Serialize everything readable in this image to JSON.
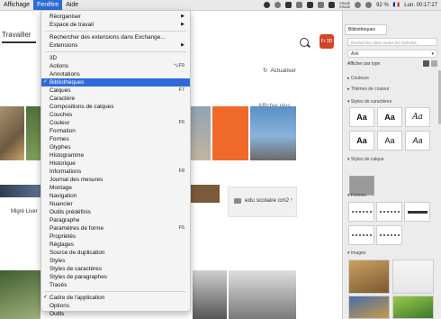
{
  "menubar": {
    "items": [
      "Affichage",
      "Fenêtre",
      "Aide"
    ],
    "right": {
      "erase_top": "ERASE",
      "erase_bottom": "ERASE",
      "battery": "92 %",
      "flag": "🇫🇷",
      "clock": "Lun. 00:17:27"
    }
  },
  "menu": {
    "rows": [
      {
        "label": "Réorganiser",
        "shortcut": "",
        "submenu": true,
        "check": false,
        "highlighted": false
      },
      {
        "label": "Espace de travail",
        "shortcut": "",
        "submenu": true,
        "check": false,
        "highlighted": false
      },
      {
        "label": "Rechercher des extensions dans Exchange...",
        "shortcut": "",
        "submenu": false,
        "check": false,
        "highlighted": false
      },
      {
        "label": "Extensions",
        "shortcut": "",
        "submenu": true,
        "check": false,
        "highlighted": false
      },
      {
        "label": "3D",
        "shortcut": "",
        "submenu": false,
        "check": false,
        "highlighted": false
      },
      {
        "label": "Actions",
        "shortcut": "⌥F9",
        "submenu": false,
        "check": false,
        "highlighted": false
      },
      {
        "label": "Annotations",
        "shortcut": "",
        "submenu": false,
        "check": false,
        "highlighted": false
      },
      {
        "label": "Bibliothèques",
        "shortcut": "",
        "submenu": false,
        "check": true,
        "highlighted": true
      },
      {
        "label": "Calques",
        "shortcut": "F7",
        "submenu": false,
        "check": false,
        "highlighted": false
      },
      {
        "label": "Caractère",
        "shortcut": "",
        "submenu": false,
        "check": false,
        "highlighted": false
      },
      {
        "label": "Compositions de calques",
        "shortcut": "",
        "submenu": false,
        "check": false,
        "highlighted": false
      },
      {
        "label": "Couches",
        "shortcut": "",
        "submenu": false,
        "check": false,
        "highlighted": false
      },
      {
        "label": "Couleur",
        "shortcut": "F6",
        "submenu": false,
        "check": false,
        "highlighted": false
      },
      {
        "label": "Formation",
        "shortcut": "",
        "submenu": false,
        "check": false,
        "highlighted": false
      },
      {
        "label": "Formes",
        "shortcut": "",
        "submenu": false,
        "check": false,
        "highlighted": false
      },
      {
        "label": "Glyphes",
        "shortcut": "",
        "submenu": false,
        "check": false,
        "highlighted": false
      },
      {
        "label": "Histogramme",
        "shortcut": "",
        "submenu": false,
        "check": false,
        "highlighted": false
      },
      {
        "label": "Historique",
        "shortcut": "",
        "submenu": false,
        "check": false,
        "highlighted": false
      },
      {
        "label": "Informations",
        "shortcut": "F8",
        "submenu": false,
        "check": false,
        "highlighted": false
      },
      {
        "label": "Journal des mesures",
        "shortcut": "",
        "submenu": false,
        "check": false,
        "highlighted": false
      },
      {
        "label": "Montage",
        "shortcut": "",
        "submenu": false,
        "check": false,
        "highlighted": false
      },
      {
        "label": "Navigation",
        "shortcut": "",
        "submenu": false,
        "check": false,
        "highlighted": false
      },
      {
        "label": "Nuancier",
        "shortcut": "",
        "submenu": false,
        "check": false,
        "highlighted": false
      },
      {
        "label": "Outils prédéfinis",
        "shortcut": "",
        "submenu": false,
        "check": false,
        "highlighted": false
      },
      {
        "label": "Paragraphe",
        "shortcut": "",
        "submenu": false,
        "check": false,
        "highlighted": false
      },
      {
        "label": "Paramètres de forme",
        "shortcut": "F5",
        "submenu": false,
        "check": false,
        "highlighted": false
      },
      {
        "label": "Propriétés",
        "shortcut": "",
        "submenu": false,
        "check": false,
        "highlighted": false
      },
      {
        "label": "Réglages",
        "shortcut": "",
        "submenu": false,
        "check": false,
        "highlighted": false
      },
      {
        "label": "Source de duplication",
        "shortcut": "",
        "submenu": false,
        "check": false,
        "highlighted": false
      },
      {
        "label": "Styles",
        "shortcut": "",
        "submenu": false,
        "check": false,
        "highlighted": false
      },
      {
        "label": "Styles de caractères",
        "shortcut": "",
        "submenu": false,
        "check": false,
        "highlighted": false
      },
      {
        "label": "Styles de paragraphes",
        "shortcut": "",
        "submenu": false,
        "check": false,
        "highlighted": false
      },
      {
        "label": "Tracés",
        "shortcut": "",
        "submenu": false,
        "check": false,
        "highlighted": false
      },
      {
        "label": "Cadre de l'application",
        "shortcut": "",
        "submenu": false,
        "check": true,
        "highlighted": false
      },
      {
        "label": "Options",
        "shortcut": "",
        "submenu": false,
        "check": false,
        "highlighted": false
      },
      {
        "label": "Outils",
        "shortcut": "",
        "submenu": false,
        "check": false,
        "highlighted": false
      }
    ]
  },
  "background": {
    "tab_label": "Travailler",
    "avatar_text": "Fr 3D",
    "actualiser": "Actualiser",
    "afficher_plus": "Afficher plus",
    "migre_label": "Migré Liver",
    "edu_label": "edu scolaire cm2"
  },
  "panel": {
    "tab": "Bibliothèques",
    "search_placeholder": "Rechercher dans toutes les bibliothè",
    "library_select": "Ask",
    "view_label": "Afficher par type",
    "sections": {
      "couleurs": "Couleurs",
      "themes": "Thèmes de couleur",
      "styles_caracteres": "Styles de caractères",
      "styles_calque": "Styles de calque",
      "formes": "Formes",
      "images": "Images"
    },
    "char_samples": [
      "Aa",
      "Aa",
      "Aa",
      "Aa",
      "Aa",
      "Aa"
    ]
  },
  "colors": {
    "accent": "#2e6bd8",
    "avatar": "#d2452b"
  }
}
